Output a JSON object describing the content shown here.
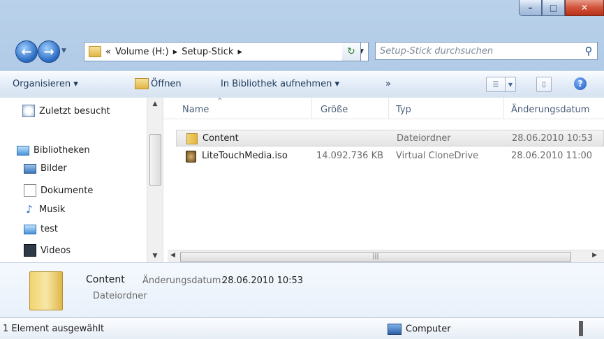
{
  "window": {
    "minimize": "–",
    "maximize": "□",
    "close": "✕"
  },
  "address": {
    "prefix": "«",
    "crumbs": [
      "Volume (H:)",
      "Setup-Stick"
    ],
    "sep": "▸",
    "search_placeholder": "Setup-Stick durchsuchen"
  },
  "toolbar": {
    "organize": "Organisieren ▾",
    "open": "Öffnen",
    "library": "In Bibliothek aufnehmen ▾",
    "more": "»",
    "help": "?"
  },
  "nav": {
    "items": [
      {
        "label": "Zuletzt besucht",
        "icon": "recent-icon"
      },
      {
        "label": "Bibliotheken",
        "icon": "library-icon"
      },
      {
        "label": "Bilder",
        "icon": "pictures-icon"
      },
      {
        "label": "Dokumente",
        "icon": "documents-icon"
      },
      {
        "label": "Musik",
        "icon": "music-icon"
      },
      {
        "label": "test",
        "icon": "library-icon"
      },
      {
        "label": "Videos",
        "icon": "video-icon"
      }
    ]
  },
  "columns": {
    "name": "Name",
    "size": "Größe",
    "type": "Typ",
    "date": "Änderungsdatum"
  },
  "files": [
    {
      "name": "Content",
      "size": "",
      "type": "Dateiordner",
      "date": "28.06.2010 10:53"
    },
    {
      "name": "LiteTouchMedia.iso",
      "size": "14.092.736 KB",
      "type": "Virtual CloneDrive",
      "date": "28.06.2010 11:00"
    }
  ],
  "details": {
    "name": "Content",
    "type": "Dateiordner",
    "modified_label": "Änderungsdatum:",
    "modified_value": "28.06.2010 10:53"
  },
  "status": {
    "selection": "1 Element ausgewählt",
    "location": "Computer"
  }
}
